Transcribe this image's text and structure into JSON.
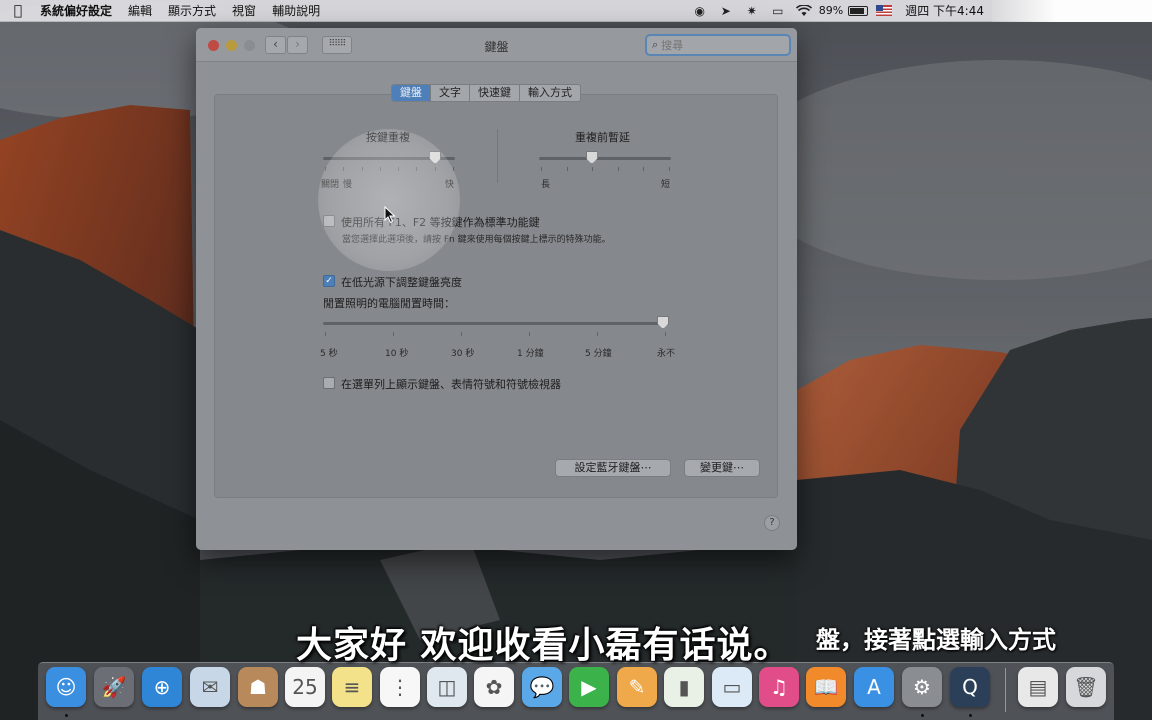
{
  "menubar": {
    "app": "系統偏好設定",
    "items": [
      "編輯",
      "顯示方式",
      "視窗",
      "輔助說明"
    ],
    "battery": "89%",
    "battery_fill": 0.89,
    "clock": "週四 下午4:44"
  },
  "window": {
    "title": "鍵盤",
    "search_placeholder": "搜尋",
    "tabs": [
      "鍵盤",
      "文字",
      "快速鍵",
      "輸入方式"
    ],
    "active_tab": "鍵盤",
    "key_repeat": {
      "title": "按鍵重複",
      "labels": [
        "關閉",
        "慢",
        "快"
      ],
      "value": 0.85
    },
    "delay": {
      "title": "重複前暫延",
      "labels": [
        "長",
        "短"
      ],
      "value": 0.4
    },
    "fn_option": {
      "label": "使用所有 F1、F2 等按鍵作為標準功能鍵",
      "hint": "當您選擇此選項後，請按 Fn 鍵來使用每個按鍵上標示的特殊功能。",
      "checked": false
    },
    "backlight_option": {
      "label": "在低光源下調整鍵盤亮度",
      "checked": true
    },
    "idle": {
      "title": "閒置照明的電腦閒置時間：",
      "labels": [
        "5 秒",
        "10 秒",
        "30 秒",
        "1 分鐘",
        "5 分鐘",
        "永不"
      ],
      "value": "永不"
    },
    "menu_option": {
      "label": "在選單列上顯示鍵盤、表情符號和符號檢視器",
      "checked": false
    },
    "buttons": {
      "bluetooth": "設定藍牙鍵盤⋯",
      "modifier": "變更鍵⋯"
    },
    "help": "?"
  },
  "subtitles": {
    "main": "大家好  欢迎收看小磊有话说。",
    "side": "盤，接著點選輸入方式"
  },
  "dock": {
    "items": [
      {
        "name": "finder",
        "icon": "finder-icon",
        "color": "#3b8fe0",
        "glyph": "☺",
        "running": true
      },
      {
        "name": "launchpad",
        "icon": "rocket-icon",
        "color": "#6b6e74",
        "glyph": "🚀",
        "running": false
      },
      {
        "name": "safari",
        "icon": "compass-icon",
        "color": "#2f86d6",
        "glyph": "⊕",
        "running": false
      },
      {
        "name": "mail",
        "icon": "stamp-icon",
        "color": "#c7d7e8",
        "glyph": "✉",
        "running": false
      },
      {
        "name": "contacts",
        "icon": "contacts-icon",
        "color": "#b8895a",
        "glyph": "☗",
        "running": false
      },
      {
        "name": "calendar",
        "icon": "calendar-icon",
        "color": "#f4f4f4",
        "glyph": "25",
        "running": false
      },
      {
        "name": "notes",
        "icon": "notes-icon",
        "color": "#f3e28a",
        "glyph": "≡",
        "running": false
      },
      {
        "name": "reminders",
        "icon": "reminders-icon",
        "color": "#f7f7f7",
        "glyph": "⋮",
        "running": false
      },
      {
        "name": "preview",
        "icon": "preview-icon",
        "color": "#dfe7ef",
        "glyph": "◫",
        "running": false
      },
      {
        "name": "photos",
        "icon": "photos-icon",
        "color": "#f5f5f5",
        "glyph": "✿",
        "running": false
      },
      {
        "name": "messages",
        "icon": "messages-icon",
        "color": "#5aa8e8",
        "glyph": "💬",
        "running": false
      },
      {
        "name": "facetime",
        "icon": "facetime-icon",
        "color": "#3cb24b",
        "glyph": "▶",
        "running": false
      },
      {
        "name": "pages",
        "icon": "pages-icon",
        "color": "#efa84a",
        "glyph": "✎",
        "running": false
      },
      {
        "name": "numbers",
        "icon": "numbers-icon",
        "color": "#e9f1e6",
        "glyph": "▮",
        "running": false
      },
      {
        "name": "keynote",
        "icon": "keynote-icon",
        "color": "#dceaf7",
        "glyph": "▭",
        "running": false
      },
      {
        "name": "itunes",
        "icon": "music-icon",
        "color": "#e04d88",
        "glyph": "♫",
        "running": false
      },
      {
        "name": "ibooks",
        "icon": "book-icon",
        "color": "#f08a2a",
        "glyph": "📖",
        "running": false
      },
      {
        "name": "app-store",
        "icon": "appstore-icon",
        "color": "#3a90e2",
        "glyph": "A",
        "running": false
      },
      {
        "name": "system-preferences",
        "icon": "gear-icon",
        "color": "#8a8d92",
        "glyph": "⚙",
        "running": true
      },
      {
        "name": "quicktime",
        "icon": "quicktime-icon",
        "color": "#2c3f58",
        "glyph": "Q",
        "running": true
      },
      {
        "name": "documents",
        "icon": "document-icon",
        "color": "#e8e8e8",
        "glyph": "▤",
        "running": false
      },
      {
        "name": "trash",
        "icon": "trash-icon",
        "color": "#d6d8dc",
        "glyph": "🗑",
        "running": false
      }
    ]
  }
}
